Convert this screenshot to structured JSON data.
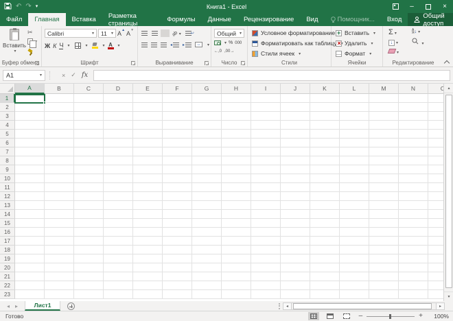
{
  "colors": {
    "excel_green": "#217346",
    "share_button": "#1b5e38",
    "ribbon_bg": "#f3f2f1",
    "selection_border": "#217346"
  },
  "icons": {
    "undo": "↶",
    "redo": "↷",
    "qat_caret": "▾",
    "minimize": "–",
    "close": "×",
    "scissors": "✂",
    "check": "✓",
    "cancel": "×",
    "caret_down": "▾",
    "arrow_left": "◂",
    "arrow_right": "▸",
    "arrow_up": "▴",
    "arrow_down": "▾",
    "sum": "Σ",
    "percent": "%",
    "thousands": "000"
  },
  "title_bar": {
    "title": "Книга1 - Excel"
  },
  "tabs": {
    "file": "Файл",
    "items": [
      "Главная",
      "Вставка",
      "Разметка страницы",
      "Формулы",
      "Данные",
      "Рецензирование",
      "Вид"
    ],
    "active": "Главная",
    "assistant": "Помощник...",
    "sign_in": "Вход",
    "share": "Общий доступ"
  },
  "ribbon": {
    "clipboard": {
      "label": "Буфер обмена",
      "paste": "Вставить"
    },
    "font": {
      "label": "Шрифт",
      "family": "Calibri",
      "size": "11",
      "bold": "Ж",
      "italic": "К",
      "underline": "Ч"
    },
    "alignment": {
      "label": "Выравнивание",
      "orientation": "ab"
    },
    "number": {
      "label": "Число",
      "format": "Общий",
      "percent": "%",
      "thousands": "000",
      "inc_decimal": "←,0",
      "dec_decimal": ",00→"
    },
    "styles": {
      "label": "Стили",
      "items": [
        "Условное форматирование",
        "Форматировать как таблицу",
        "Стили ячеек"
      ]
    },
    "cells": {
      "label": "Ячейки",
      "items": [
        "Вставить",
        "Удалить",
        "Формат"
      ]
    },
    "editing": {
      "label": "Редактирование",
      "sort_letters_top": "А",
      "sort_letters_bottom": "Я"
    }
  },
  "formula_bar": {
    "name_box": "A1",
    "fx": "fx",
    "value": ""
  },
  "grid": {
    "columns": [
      "A",
      "B",
      "C",
      "D",
      "E",
      "F",
      "G",
      "H",
      "I",
      "J",
      "K",
      "L",
      "M",
      "N",
      "O"
    ],
    "rows": [
      "1",
      "2",
      "3",
      "4",
      "5",
      "6",
      "7",
      "8",
      "9",
      "10",
      "11",
      "12",
      "13",
      "14",
      "15",
      "16",
      "17",
      "18",
      "19",
      "20",
      "21",
      "22",
      "23"
    ],
    "selected_column": "A",
    "selected_row": "1",
    "selected_cell": "A1"
  },
  "sheet_bar": {
    "active_tab": "Лист1"
  },
  "status_bar": {
    "status": "Готово",
    "zoom": "100%"
  }
}
